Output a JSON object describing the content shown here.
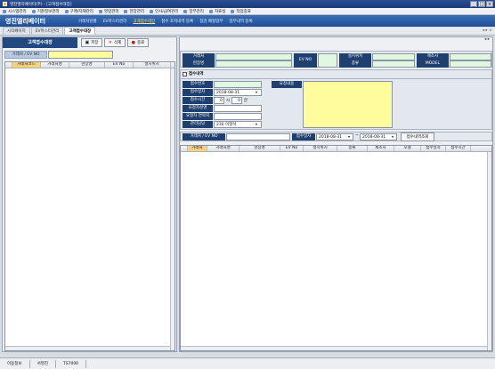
{
  "window": {
    "title": "영진엘리베이터(주) - [고객접수대장]"
  },
  "menu": [
    "시스템관리",
    "기준정보관리",
    "구매/자재관리",
    "영업관리",
    "현장관리",
    "인사/급여관리",
    "장부관리",
    "자료실",
    "작업종료"
  ],
  "banner": {
    "logo": "영진엘리베이터",
    "nav": [
      "거래처현황",
      "EV마스터관리",
      "고객접수대장",
      "접수 조치내역 등록",
      "점검 배정업무",
      "업무내역 등록"
    ]
  },
  "tabs": [
    "시작페이지",
    "EV마스터관리",
    "고객접수대장"
  ],
  "page_title": "고객접수대장",
  "toolbar": {
    "save": "저장",
    "delete": "삭제",
    "close": "종료"
  },
  "left": {
    "search_label": "거래처 / EV NO",
    "search_value": "",
    "columns": [
      "거래처코드",
      "거래처명",
      "현장명",
      "EV No",
      "설치위치"
    ]
  },
  "info": {
    "customer_label": "거래처",
    "site_label": "현장명",
    "evno_label": "EV NO",
    "location_label": "설치위치",
    "type_label": "종류",
    "maker_label": "제조사",
    "model_label": "MODEL"
  },
  "receipt": {
    "section_title": "접수내역",
    "no_label": "접수번호",
    "date_label": "접수일자",
    "date_value": "2018-08-31",
    "time_label": "접수시간",
    "time_hour": "0",
    "time_hour_unit": "시",
    "time_min": "0",
    "time_min_unit": "분",
    "requester_label": "요청자성명",
    "contact_label": "요청자 연락처",
    "manager_label": "관리담당",
    "manager_value": "230 이형석",
    "content_label": "요청내용"
  },
  "filter": {
    "label": "거래처 / EV NO",
    "date_label": "접수일자",
    "from": "2018-08-31",
    "to": "2018-08-31",
    "button": "접수내역조회"
  },
  "right_grid": {
    "columns": [
      "거래처",
      "거래처명",
      "현장명",
      "EV No",
      "설치위치",
      "종류",
      "제조사",
      "모델",
      "접수일자",
      "접수시간"
    ]
  },
  "status": [
    "이동정보",
    "서영진",
    "TS7000"
  ]
}
